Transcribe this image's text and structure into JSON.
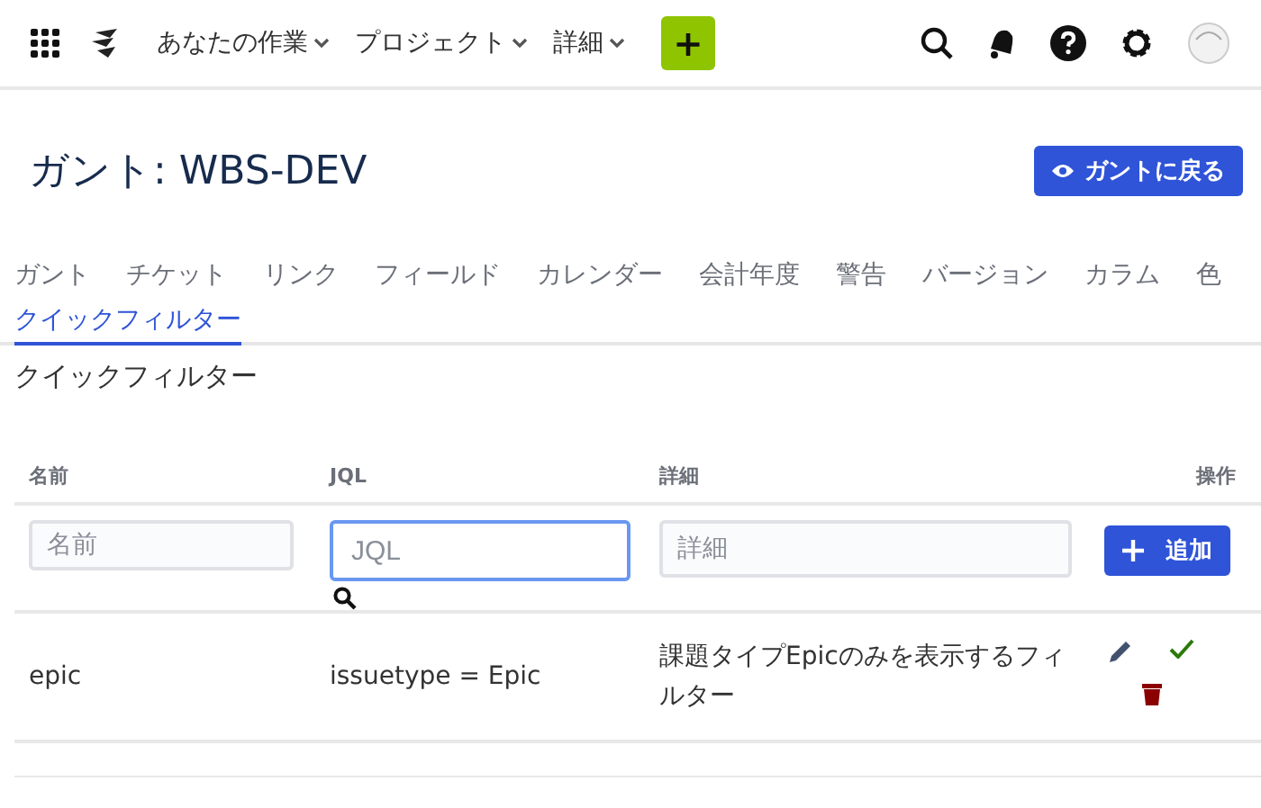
{
  "nav": {
    "menus": [
      {
        "label": "あなたの作業"
      },
      {
        "label": "プロジェクト"
      },
      {
        "label": "詳細"
      }
    ],
    "create_button": "+"
  },
  "header": {
    "title": "ガント: WBS-DEV",
    "back_button": "ガントに戻る"
  },
  "tabs": [
    {
      "label": "ガント",
      "selected": false
    },
    {
      "label": "チケット",
      "selected": false
    },
    {
      "label": "リンク",
      "selected": false
    },
    {
      "label": "フィールド",
      "selected": false
    },
    {
      "label": "カレンダー",
      "selected": false
    },
    {
      "label": "会計年度",
      "selected": false
    },
    {
      "label": "警告",
      "selected": false
    },
    {
      "label": "バージョン",
      "selected": false
    },
    {
      "label": "カラム",
      "selected": false
    },
    {
      "label": "色",
      "selected": false
    },
    {
      "label": "クイックフィルター",
      "selected": true
    }
  ],
  "section_title": "クイックフィルター",
  "table": {
    "columns": [
      "名前",
      "JQL",
      "詳細",
      "操作"
    ],
    "new_row": {
      "fields": [
        {
          "placeholder": "名前",
          "focused": false
        },
        {
          "placeholder": "JQL",
          "focused": true
        },
        {
          "placeholder": "詳細",
          "focused": false
        }
      ],
      "add_button": "追加"
    },
    "rows": [
      {
        "name": "epic",
        "jql": "issuetype = Epic",
        "description": "課題タイプEpicのみを表示するフィルター"
      }
    ]
  }
}
